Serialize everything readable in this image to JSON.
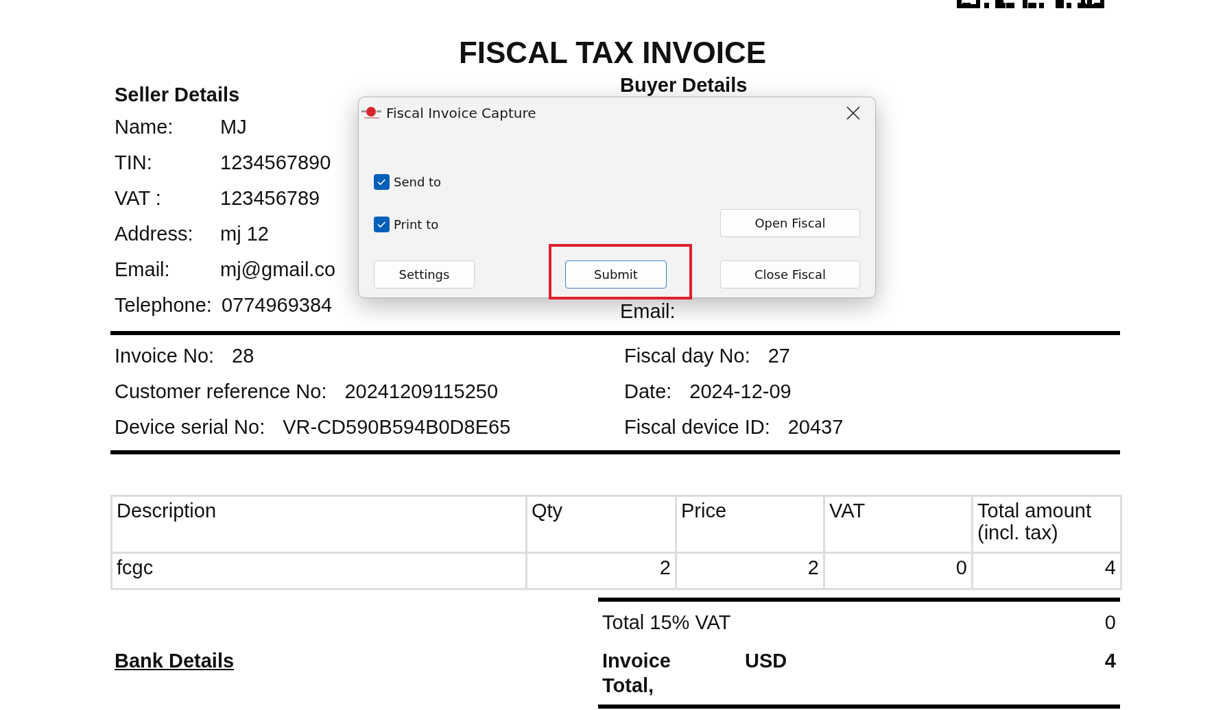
{
  "title": "FISCAL TAX INVOICE",
  "seller": {
    "heading": "Seller Details",
    "fields": [
      {
        "label": "Name:",
        "value": "MJ"
      },
      {
        "label": "TIN:",
        "value": "1234567890"
      },
      {
        "label": "VAT :",
        "value": "123456789"
      },
      {
        "label": "Address:",
        "value": "mj 12"
      },
      {
        "label": "Email:",
        "value": "mj@gmail.co"
      },
      {
        "label": "Telephone:",
        "value": "0774969384"
      }
    ]
  },
  "buyer": {
    "heading": "Buyer Details",
    "fields": [
      {
        "label": "Email:"
      }
    ]
  },
  "invoice_info": {
    "left": [
      {
        "label": "Invoice No:",
        "value": "28"
      },
      {
        "label": "Customer reference No:",
        "value": "20241209115250"
      },
      {
        "label": "Device serial No:",
        "value": "VR-CD590B594B0D8E65"
      }
    ],
    "right": [
      {
        "label": "Fiscal day No:",
        "value": "27"
      },
      {
        "label": "Date:",
        "value": "2024-12-09"
      },
      {
        "label": "Fiscal device ID:",
        "value": "20437"
      }
    ]
  },
  "table": {
    "columns": [
      "Description",
      "Qty",
      "Price",
      "VAT",
      "Total amount (incl. tax)"
    ],
    "rows": [
      [
        "fcgc",
        "2",
        "2",
        "0",
        "4"
      ]
    ]
  },
  "totals": [
    {
      "kind": "plain",
      "label": "Total 15% VAT",
      "value": "0"
    },
    {
      "kind": "bold",
      "label": "Invoice Total,",
      "currency": "USD",
      "value": "4"
    }
  ],
  "bank_details": "Bank Details",
  "dialog": {
    "title": "Fiscal Invoice Capture",
    "checkboxes": [
      {
        "label": "Send to",
        "checked": true
      },
      {
        "label": "Print to",
        "checked": true
      }
    ],
    "buttons": [
      {
        "label": "Open Fiscal",
        "kind": "plain",
        "highlighted": false
      },
      {
        "label": "Settings",
        "kind": "plain",
        "highlighted": false
      },
      {
        "label": "Submit",
        "kind": "default",
        "highlighted": true
      },
      {
        "label": "Close Fiscal",
        "kind": "plain",
        "highlighted": false
      }
    ]
  }
}
